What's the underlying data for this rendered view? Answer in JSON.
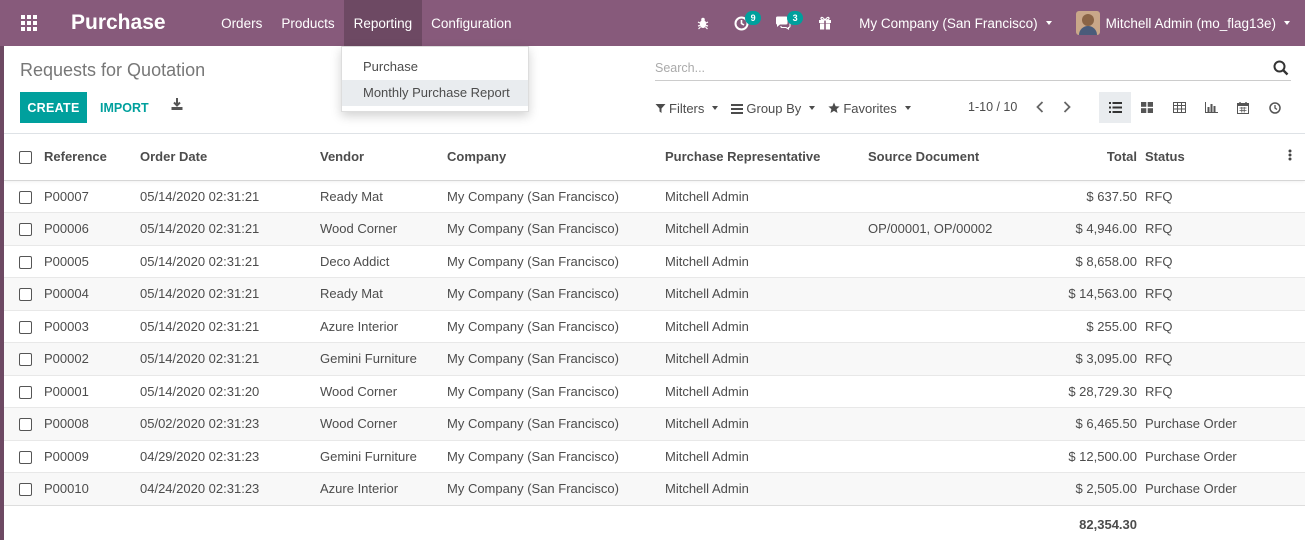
{
  "navbar": {
    "brand": "Purchase",
    "menu": [
      "Orders",
      "Products",
      "Reporting",
      "Configuration"
    ],
    "active_menu": "Reporting",
    "activity_badge": "9",
    "messages_badge": "3",
    "company": "My Company (San Francisco)",
    "user": "Mitchell Admin (mo_flag13e)"
  },
  "dropdown": {
    "items": [
      "Purchase",
      "Monthly Purchase Report"
    ]
  },
  "control_panel": {
    "breadcrumb": "Requests for Quotation",
    "create_label": "CREATE",
    "import_label": "IMPORT",
    "search_placeholder": "Search...",
    "filters_label": "Filters",
    "group_by_label": "Group By",
    "favorites_label": "Favorites",
    "pager": "1-10 / 10"
  },
  "table": {
    "columns": [
      "Reference",
      "Order Date",
      "Vendor",
      "Company",
      "Purchase Representative",
      "Source Document",
      "Total",
      "Status"
    ],
    "rows": [
      {
        "ref": "P00007",
        "date": "05/14/2020 02:31:21",
        "vendor": "Ready Mat",
        "company": "My Company (San Francisco)",
        "rep": "Mitchell Admin",
        "source": "",
        "total": "$ 637.50",
        "status": "RFQ"
      },
      {
        "ref": "P00006",
        "date": "05/14/2020 02:31:21",
        "vendor": "Wood Corner",
        "company": "My Company (San Francisco)",
        "rep": "Mitchell Admin",
        "source": "OP/00001, OP/00002",
        "total": "$ 4,946.00",
        "status": "RFQ"
      },
      {
        "ref": "P00005",
        "date": "05/14/2020 02:31:21",
        "vendor": "Deco Addict",
        "company": "My Company (San Francisco)",
        "rep": "Mitchell Admin",
        "source": "",
        "total": "$ 8,658.00",
        "status": "RFQ"
      },
      {
        "ref": "P00004",
        "date": "05/14/2020 02:31:21",
        "vendor": "Ready Mat",
        "company": "My Company (San Francisco)",
        "rep": "Mitchell Admin",
        "source": "",
        "total": "$ 14,563.00",
        "status": "RFQ"
      },
      {
        "ref": "P00003",
        "date": "05/14/2020 02:31:21",
        "vendor": "Azure Interior",
        "company": "My Company (San Francisco)",
        "rep": "Mitchell Admin",
        "source": "",
        "total": "$ 255.00",
        "status": "RFQ"
      },
      {
        "ref": "P00002",
        "date": "05/14/2020 02:31:21",
        "vendor": "Gemini Furniture",
        "company": "My Company (San Francisco)",
        "rep": "Mitchell Admin",
        "source": "",
        "total": "$ 3,095.00",
        "status": "RFQ"
      },
      {
        "ref": "P00001",
        "date": "05/14/2020 02:31:20",
        "vendor": "Wood Corner",
        "company": "My Company (San Francisco)",
        "rep": "Mitchell Admin",
        "source": "",
        "total": "$ 28,729.30",
        "status": "RFQ"
      },
      {
        "ref": "P00008",
        "date": "05/02/2020 02:31:23",
        "vendor": "Wood Corner",
        "company": "My Company (San Francisco)",
        "rep": "Mitchell Admin",
        "source": "",
        "total": "$ 6,465.50",
        "status": "Purchase Order"
      },
      {
        "ref": "P00009",
        "date": "04/29/2020 02:31:23",
        "vendor": "Gemini Furniture",
        "company": "My Company (San Francisco)",
        "rep": "Mitchell Admin",
        "source": "",
        "total": "$ 12,500.00",
        "status": "Purchase Order"
      },
      {
        "ref": "P00010",
        "date": "04/24/2020 02:31:23",
        "vendor": "Azure Interior",
        "company": "My Company (San Francisco)",
        "rep": "Mitchell Admin",
        "source": "",
        "total": "$ 2,505.00",
        "status": "Purchase Order"
      }
    ],
    "grand_total": "82,354.30"
  },
  "icons": {
    "apps": "apps-grid-icon",
    "bug": "bug-icon",
    "activity": "clock-icon",
    "messages": "chat-icon",
    "gift": "gift-icon",
    "download": "download-icon",
    "search": "search-icon",
    "views": [
      "list-view-icon",
      "kanban-view-icon",
      "pivot-view-icon",
      "graph-view-icon",
      "calendar-view-icon",
      "activity-view-icon"
    ]
  },
  "colors": {
    "navbar": "#875a7b",
    "navbar_active": "#6d4963",
    "primary": "#00a09d"
  }
}
